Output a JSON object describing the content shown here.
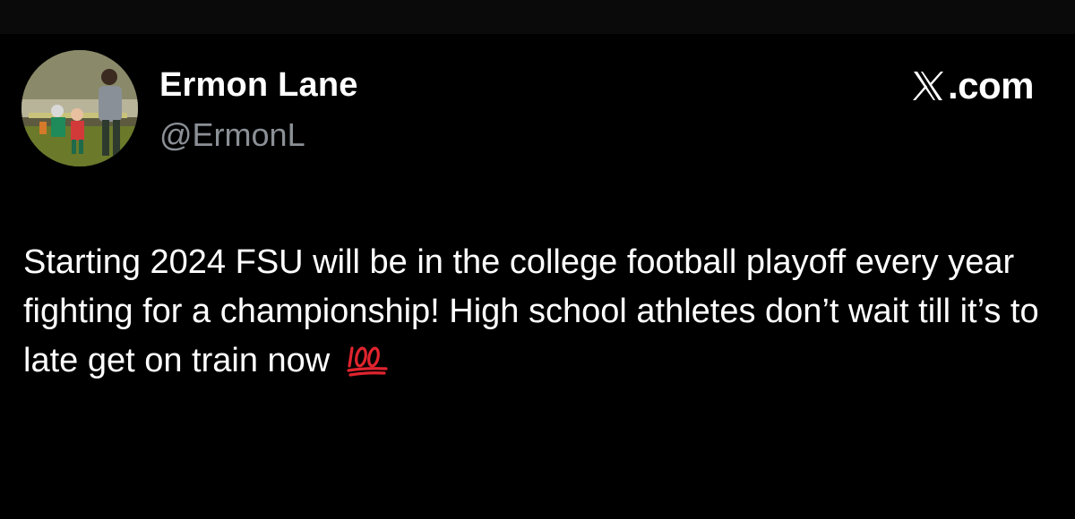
{
  "author": {
    "display_name": "Ermon Lane",
    "handle": "@ErmonL",
    "avatar_icon": "profile-photo"
  },
  "brand": {
    "logo_icon": "x-logo-icon",
    "text": ".com"
  },
  "tweet": {
    "text": "Starting 2024 FSU will be in the college football playoff every year fighting for a championship! High school athletes don’t wait till it’s to late get on train now",
    "emoji": "hundred-points-emoji"
  },
  "colors": {
    "background": "#000000",
    "text_primary": "#ffffff",
    "text_secondary": "#8b9096",
    "emoji_red": "#e0242e"
  }
}
